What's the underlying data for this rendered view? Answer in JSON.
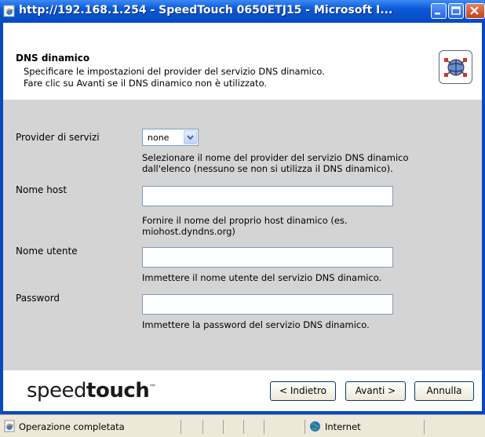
{
  "window": {
    "title": "http://192.168.1.254 - SpeedTouch       0650ETJ15 - Microsoft I..."
  },
  "header": {
    "title": "DNS dinamico",
    "description_line1": "Specificare le impostazioni del provider del servizio DNS dinamico.",
    "description_line2": "Fare clic su Avanti se il DNS dinamico non è utilizzato."
  },
  "form": {
    "provider": {
      "label": "Provider di servizi",
      "value": "none",
      "help_line1": "Selezionare il nome del provider del servizio DNS dinamico",
      "help_line2": "dall'elenco (nessuno se non si utilizza il DNS dinamico)."
    },
    "host": {
      "label": "Nome host",
      "value": "",
      "help_line1": "Fornire il nome del proprio host dinamico (es.",
      "help_line2": "miohost.dyndns.org)"
    },
    "user": {
      "label": "Nome utente",
      "value": "",
      "help": "Immettere il nome utente del servizio DNS dinamico."
    },
    "password": {
      "label": "Password",
      "value": "",
      "help": "Immettere la password del servizio DNS dinamico."
    }
  },
  "footer": {
    "logo_light": "speed",
    "logo_bold": "touch",
    "logo_tm": "™",
    "back_label": "< Indietro",
    "next_label": "Avanti >",
    "cancel_label": "Annulla"
  },
  "statusbar": {
    "status": "Operazione completata",
    "zone": "Internet"
  }
}
